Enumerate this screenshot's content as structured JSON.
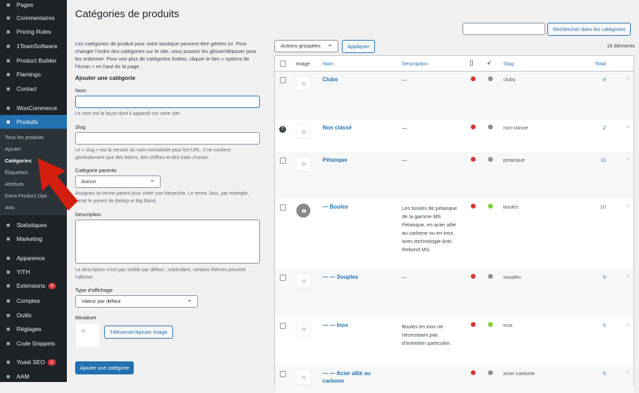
{
  "sidebar": {
    "items": [
      {
        "label": "Pages",
        "icon": "pages-icon"
      },
      {
        "label": "Commentaires",
        "icon": "comments-icon"
      },
      {
        "label": "Pricing Rules",
        "icon": "pricing-icon"
      },
      {
        "label": "1TeamSoftware",
        "icon": "bug-icon"
      },
      {
        "label": "Product Builder",
        "icon": "v-icon"
      },
      {
        "label": "Flamingo",
        "icon": "flamingo-icon"
      },
      {
        "label": "Contact",
        "icon": "mail-icon"
      },
      {
        "label": "WooCommerce",
        "icon": "woo-icon"
      },
      {
        "label": "Produits",
        "icon": "archive-icon"
      },
      {
        "label": "Statistiques",
        "icon": "chart-icon"
      },
      {
        "label": "Marketing",
        "icon": "megaphone-icon"
      },
      {
        "label": "Apparence",
        "icon": "brush-icon"
      },
      {
        "label": "YITH",
        "icon": "yith-icon"
      },
      {
        "label": "Extensions",
        "icon": "plugin-icon",
        "badge": "8"
      },
      {
        "label": "Comptes",
        "icon": "user-icon"
      },
      {
        "label": "Outils",
        "icon": "wrench-icon"
      },
      {
        "label": "Réglages",
        "icon": "settings-icon"
      },
      {
        "label": "Code Snippets",
        "icon": "code-icon"
      },
      {
        "label": "Yoast SEO",
        "icon": "yoast-icon",
        "badge": "2"
      },
      {
        "label": "AAM",
        "icon": "aam-icon"
      }
    ],
    "sub": [
      "Tous les produits",
      "Ajouter",
      "Catégories",
      "Étiquettes",
      "Attributs",
      "Extra Product Opti",
      "Avis"
    ]
  },
  "page": {
    "title": "Catégories de produits",
    "intro": "Les catégories de produit pour votre boutique peuvent être gérées ici. Pour changer l’ordre des catégories sur le site, vous pouvez les glisser/déposer pour les ordonner. Pour voir plus de catégories listées, cliquer le lien « options de l’écran » en haut de la page.",
    "add_heading": "Ajouter une catégorie",
    "name_label": "Nom",
    "name_hint": "Le nom est la façon dont il apparaît sur votre site.",
    "slug_label": "Slug",
    "slug_hint": "Le « slug » est la version du nom normalisée pour les URL. Il ne contient généralement que des lettres, des chiffres et des traits d’union.",
    "parent_label": "Catégorie parente",
    "parent_value": "Aucun",
    "parent_hint": "Assignez un terme parent pour créer une hiérarchie. Le terme Jazz, par exemple, serait le parent de Bebop et Big Band.",
    "desc_label": "Description",
    "desc_hint": "La description n’est pas visible par défaut ; cependant, certains thèmes peuvent l’afficher.",
    "display_label": "Type d’affichage",
    "display_value": "Valeur par défaut",
    "thumb_label": "Miniature",
    "upload_btn": "Téléverser/Ajouter image",
    "submit_btn": "Ajouter une catégorie"
  },
  "toolbar": {
    "search_btn": "Rechercher dans les catégories",
    "bulk": "Actions groupées",
    "apply": "Appliquer",
    "count": "16 éléments"
  },
  "table": {
    "headers": {
      "image": "Image",
      "name": "Nom",
      "description": "Description",
      "slug": "Slug",
      "total": "Total"
    },
    "rows": [
      {
        "name": "Clubs",
        "desc": "—",
        "slug": "clubs",
        "total": "0",
        "c1": "#d63638",
        "c2": "#8c8f94"
      },
      {
        "name": "Non classé",
        "desc": "—",
        "slug": "non-classe",
        "total": "2",
        "c1": "#d63638",
        "c2": "#8c8f94"
      },
      {
        "name": "Pétanque",
        "desc": "—",
        "slug": "petanque",
        "total": "11",
        "c1": "#d63638",
        "c2": "#8c8f94"
      },
      {
        "name": "— Boules",
        "desc": "Les boules de pétanque de la gamme MS Pétanque, en acier allié au carbone ou en inox, avec technologie Anti-Rebond MS.",
        "slug": "boules",
        "total": "10",
        "c1": "#d63638",
        "c2": "#7ad03a"
      },
      {
        "name": "— — Souples",
        "desc": "—",
        "slug": "souples",
        "total": "0",
        "c1": "#d63638",
        "c2": "#8c8f94"
      },
      {
        "name": "— — Inox",
        "desc": "Boules en inox ne nécessitant pas d’entretien particulier.",
        "slug": "inox",
        "total": "5",
        "c1": "#d63638",
        "c2": "#7ad03a"
      },
      {
        "name": "— — Acier allié au carbone",
        "desc": "",
        "slug": "acier-carbone",
        "total": "5",
        "c1": "#d63638",
        "c2": "#8c8f94"
      }
    ]
  }
}
